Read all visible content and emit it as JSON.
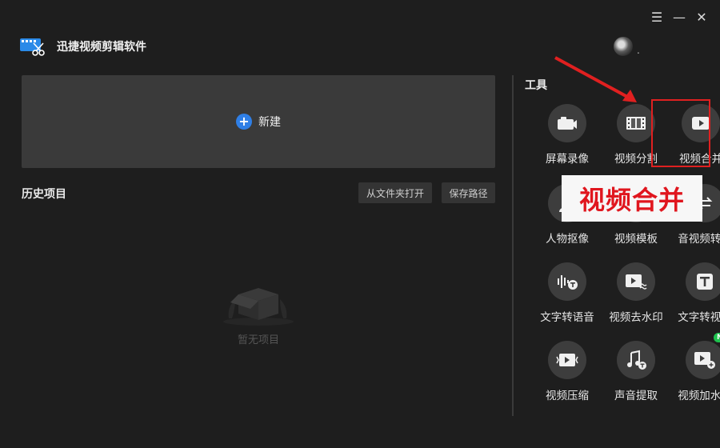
{
  "app": {
    "title": "迅捷视频剪辑软件"
  },
  "window": {
    "menu_glyph": "☰",
    "minimize_glyph": "—",
    "close_glyph": "✕"
  },
  "new_project": {
    "label": "新建",
    "plus_glyph": "+"
  },
  "history": {
    "title": "历史项目",
    "open_from_folder": "从文件夹打开",
    "save_path": "保存路径",
    "empty_text": "暂无项目"
  },
  "tools": {
    "title": "工具",
    "items": [
      {
        "label": "屏幕录像",
        "icon": "camera-icon"
      },
      {
        "label": "视频分割",
        "icon": "film-strip-icon"
      },
      {
        "label": "视频合并",
        "icon": "play-icon"
      },
      {
        "label": "人物抠像",
        "icon": "person-cutout-icon"
      },
      {
        "label": "视频模板",
        "icon": "template-icon"
      },
      {
        "label": "音视频转换",
        "icon": "convert-icon"
      },
      {
        "label": "文字转语音",
        "icon": "text-to-speech-icon"
      },
      {
        "label": "视频去水印",
        "icon": "remove-watermark-icon"
      },
      {
        "label": "文字转视频",
        "icon": "text-icon"
      },
      {
        "label": "视频压缩",
        "icon": "compress-icon"
      },
      {
        "label": "声音提取",
        "icon": "music-extract-icon"
      },
      {
        "label": "视频加水印",
        "icon": "add-watermark-icon",
        "badge": "NEW"
      }
    ]
  },
  "annotation": {
    "callout_text": "视频合并",
    "color": "#e02020"
  },
  "colors": {
    "accent": "#2f7fe6",
    "badge": "#1ec24e",
    "background": "#1e1e1e"
  }
}
